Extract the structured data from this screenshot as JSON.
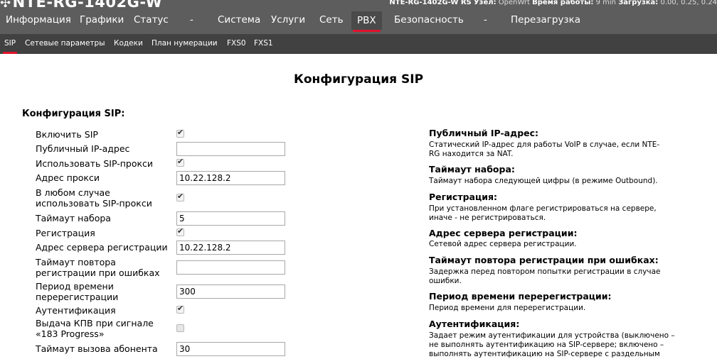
{
  "header": {
    "brand": "NTE-RG-1402G-W",
    "status": {
      "device": "NTE-RG-1402G-W RS",
      "node_label": "Узел:",
      "node_value": "OpenWrt",
      "uptime_label": "Время работы:",
      "uptime_value": "9 min",
      "load_label": "Загрузка:",
      "load_value": "0.00, 0.25, 0.24"
    }
  },
  "main_menu": {
    "info": "Информация",
    "graphs": "Графики",
    "status": "Статус",
    "dash1": "-",
    "system": "Система",
    "services": "Услуги",
    "network": "Сеть",
    "pbx": "PBX",
    "security": "Безопасность",
    "dash2": "-",
    "reboot": "Перезагрузка"
  },
  "sub_menu": {
    "sip": "SIP",
    "network_params": "Сетевые параметры",
    "codecs": "Кодеки",
    "numbering_plan": "План нумерации",
    "fxs0": "FXS0",
    "fxs1": "FXS1"
  },
  "page": {
    "title": "Конфигурация SIP",
    "section_title": "Конфигурация SIP:"
  },
  "form": {
    "enable_sip": {
      "label": "Включить SIP",
      "checked": true
    },
    "public_ip": {
      "label": "Публичный IP-адрес",
      "value": ""
    },
    "use_proxy": {
      "label": "Использовать SIP-прокси",
      "checked": true
    },
    "proxy_address": {
      "label": "Адрес прокси",
      "value": "10.22.128.2"
    },
    "always_proxy": {
      "label_line1": "В любом случае",
      "label_line2": "использовать SIP-прокси",
      "checked": true
    },
    "dial_timeout": {
      "label": "Таймаут набора",
      "value": "5"
    },
    "registration": {
      "label": "Регистрация",
      "checked": true
    },
    "reg_server": {
      "label": "Адрес сервера регистрации",
      "value": "10.22.128.2"
    },
    "reg_retry": {
      "label_line1": "Таймаут повтора",
      "label_line2": "регистрации при ошибках",
      "value": ""
    },
    "rereg_period": {
      "label_line1": "Период времени",
      "label_line2": "перерегистрации",
      "value": "300"
    },
    "auth": {
      "label": "Аутентификация",
      "checked": true
    },
    "kpv_183": {
      "label_line1": "Выдача КПВ при сигнале",
      "label_line2": "«183 Progress»",
      "checked": false
    },
    "call_timeout": {
      "label": "Таймаут вызова абонента",
      "value": "30"
    }
  },
  "help": {
    "public_ip": {
      "title": "Публичный IP-адрес:",
      "line1": "Статический IP-адрес для работы VoIP в случае, если NTE-",
      "line2": "RG находится за NAT."
    },
    "dial_timeout": {
      "title": "Таймаут набора:",
      "line1": "Таймаут набора следующей цифры (в режиме Outbound)."
    },
    "registration": {
      "title": "Регистрация:",
      "line1": "При установленном флаге регистрироваться на сервере,",
      "line2": "иначе - не регистрироваться."
    },
    "reg_server": {
      "title": "Адрес сервера регистрации:",
      "line1": "Сетевой адрес сервера регистрации."
    },
    "reg_retry": {
      "title": "Таймаут повтора регистрации при ошибках:",
      "line1": "Задержка перед повтором попытки регистрации в случае",
      "line2": "ошибки."
    },
    "rereg_period": {
      "title": "Период времени перерегистрации:",
      "line1": "Период времени для перерегистрации."
    },
    "auth": {
      "title": "Аутентификация:",
      "line1": "Задает режим аутентификации для устройства (выключено –",
      "line2": "не выполнять аутентификацию на SIP-сервере; включено –",
      "line3": "выполнять аутентификацию на SIP-сервере с раздельным"
    }
  },
  "colors": {
    "header_bg": "#5d5d5d",
    "submenu_bg": "#414141",
    "accent": "#e0122c"
  }
}
